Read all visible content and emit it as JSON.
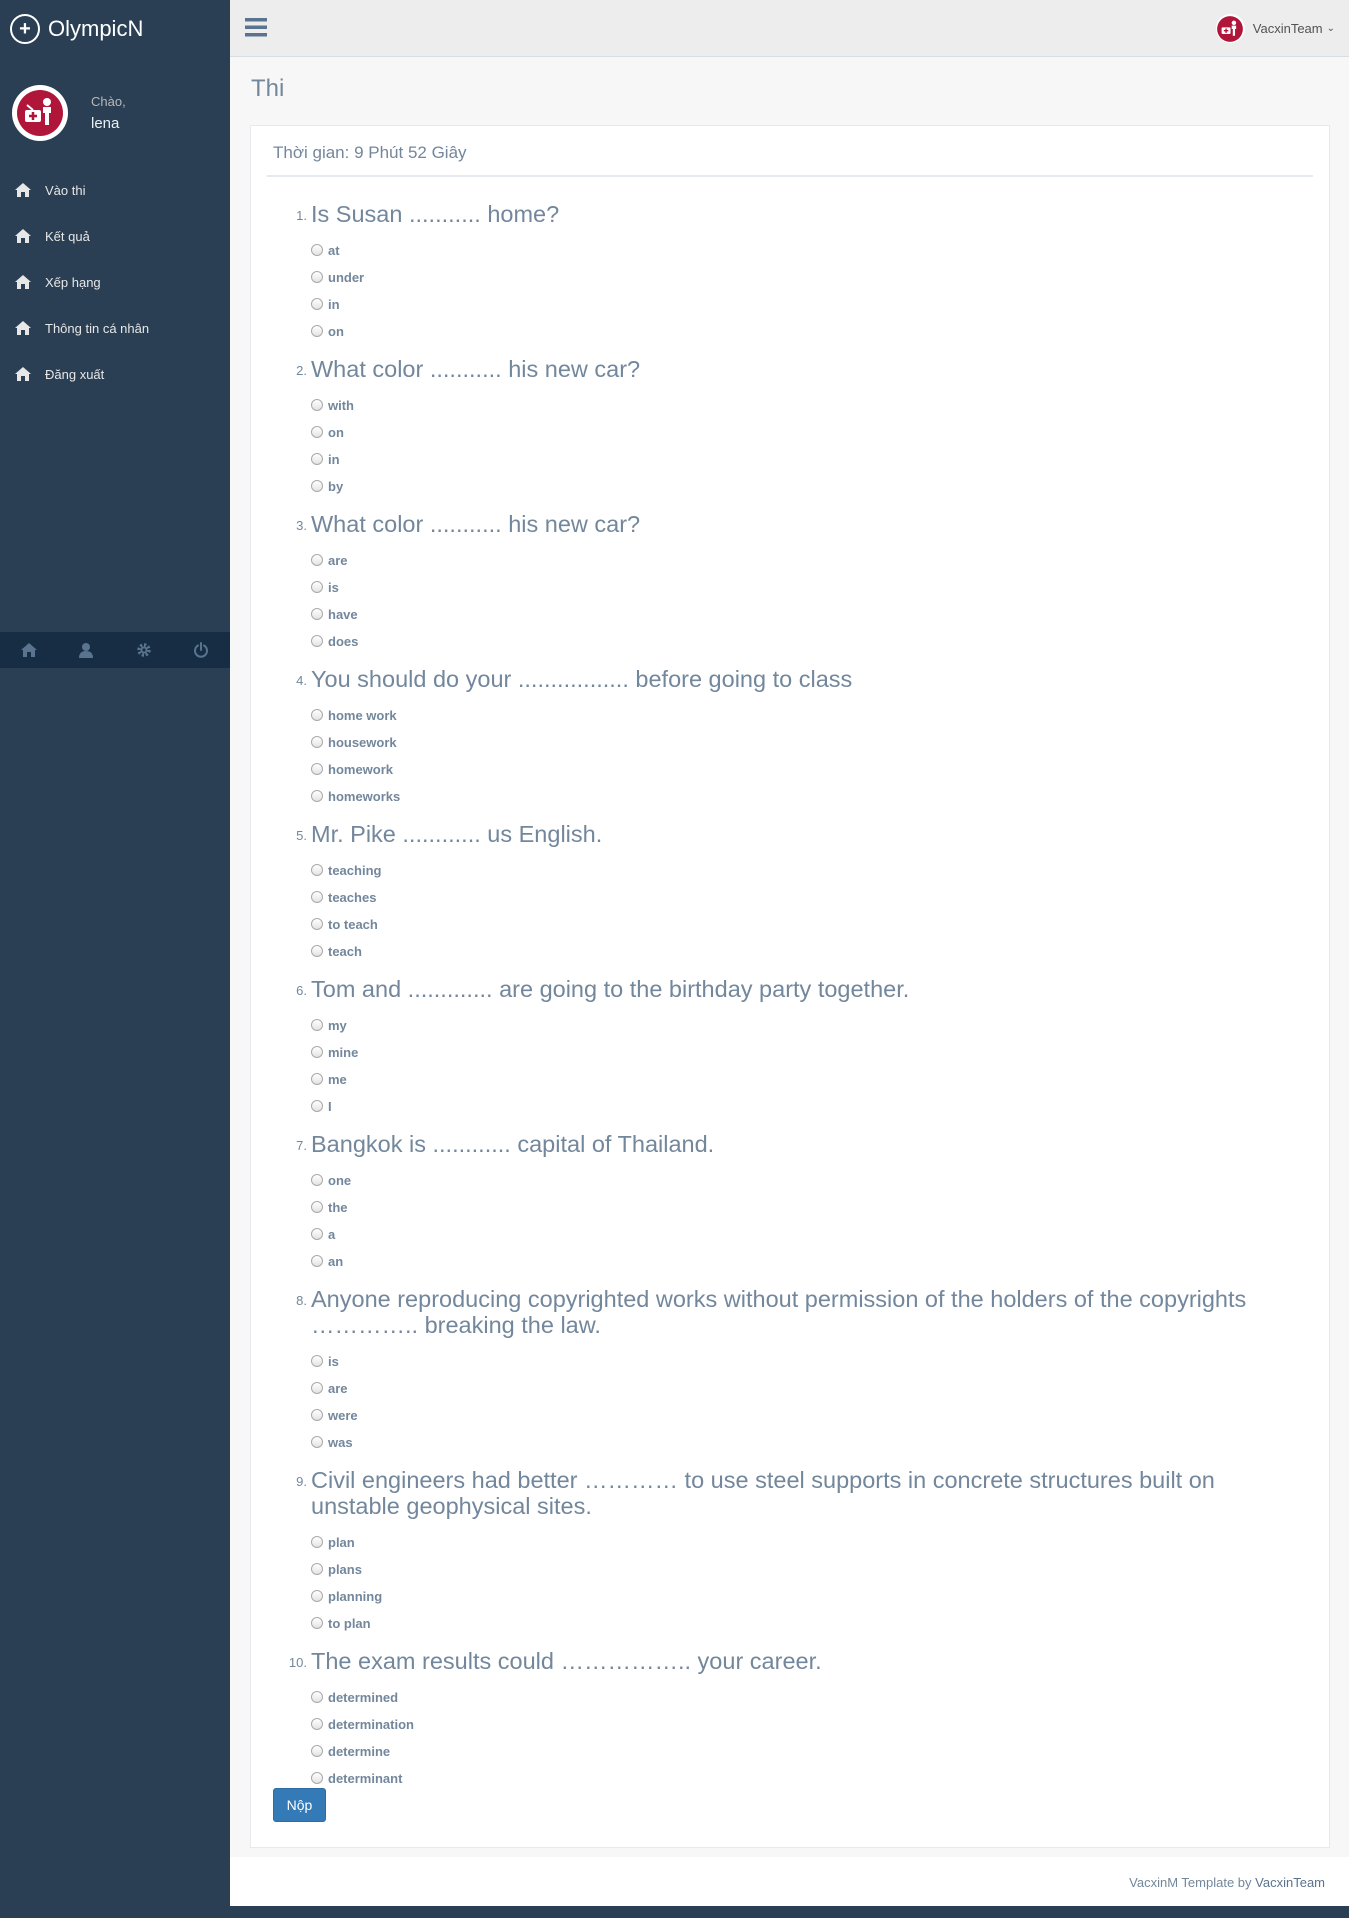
{
  "brand": {
    "name": "OlympicN"
  },
  "profile": {
    "greeting": "Chào,",
    "username": "lena"
  },
  "sidebar": {
    "items": [
      {
        "label": "Vào thi",
        "icon": "home-icon"
      },
      {
        "label": "Kết quả",
        "icon": "home-icon"
      },
      {
        "label": "Xếp hạng",
        "icon": "home-icon"
      },
      {
        "label": "Thông tin cá nhân",
        "icon": "home-icon"
      },
      {
        "label": "Đăng xuất",
        "icon": "home-icon"
      }
    ],
    "footer_icons": [
      "home-icon",
      "user-icon",
      "gear-icon",
      "power-icon"
    ]
  },
  "topnav": {
    "user": "VacxinTeam"
  },
  "page": {
    "title": "Thi",
    "timer": "Thời gian: 9 Phút 52 Giây",
    "submit_label": "Nộp"
  },
  "questions": [
    {
      "num": "1.",
      "text": "Is Susan ........... home?",
      "options": [
        "at",
        "under",
        "in",
        "on"
      ]
    },
    {
      "num": "2.",
      "text": "What color ........... his new car?",
      "options": [
        "with",
        "on",
        "in",
        "by"
      ]
    },
    {
      "num": "3.",
      "text": "What color ........... his new car?",
      "options": [
        "are",
        "is",
        "have",
        "does"
      ]
    },
    {
      "num": "4.",
      "text": "You should do your ................. before going to class",
      "options": [
        "home work",
        "housework",
        "homework",
        "homeworks"
      ]
    },
    {
      "num": "5.",
      "text": "Mr. Pike ............ us English.",
      "options": [
        "teaching",
        "teaches",
        "to teach",
        "teach"
      ]
    },
    {
      "num": "6.",
      "text": "Tom and ............. are going to the birthday party together.",
      "options": [
        "my",
        "mine",
        "me",
        "I"
      ]
    },
    {
      "num": "7.",
      "text": "Bangkok is ............ capital of Thailand.",
      "options": [
        "one",
        "the",
        "a",
        "an"
      ]
    },
    {
      "num": "8.",
      "text": "Anyone reproducing copyrighted works without permission of the holders of the copyrights ………….. breaking the law.",
      "options": [
        "is",
        "are",
        "were",
        "was"
      ]
    },
    {
      "num": "9.",
      "text": "Civil engineers had better ………… to use steel supports in concrete structures built on unstable geophysical sites.",
      "options": [
        "plan",
        "plans",
        "planning",
        "to plan"
      ]
    },
    {
      "num": "10.",
      "text": "The exam results could …………….. your career.",
      "options": [
        "determined",
        "determination",
        "determine",
        "determinant"
      ]
    }
  ],
  "footer": {
    "prefix": "VacxinM Template by",
    "author": "VacxinTeam"
  },
  "colors": {
    "sidebar_bg": "#2A3F54",
    "primary_button": "#337AB7",
    "text": "#73879C"
  }
}
